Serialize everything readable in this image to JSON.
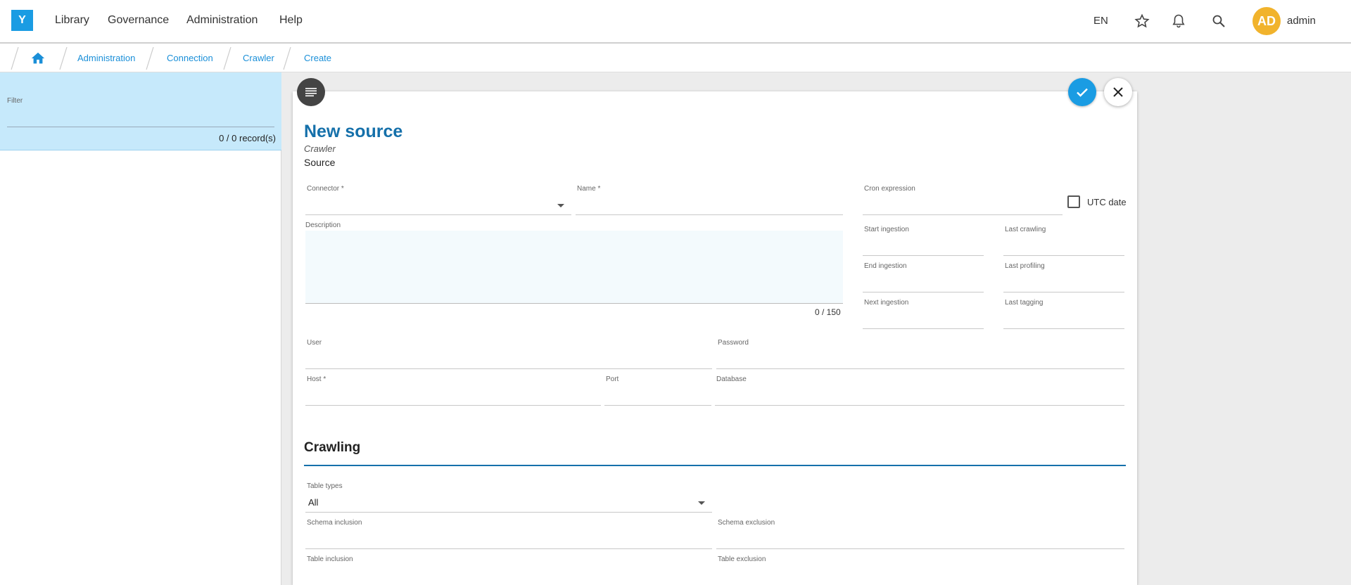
{
  "header": {
    "logo": "Y",
    "menu": [
      "Library",
      "Governance",
      "Administration",
      "Help"
    ],
    "language": "EN",
    "avatar_initials": "AD",
    "username": "admin"
  },
  "breadcrumb": [
    "Administration",
    "Connection",
    "Crawler",
    "Create"
  ],
  "left_panel": {
    "filter_label": "Filter",
    "record_count": "0 / 0 record(s)"
  },
  "form": {
    "title": "New source",
    "subtitle": "Crawler",
    "section": "Source",
    "connector_label": "Connector *",
    "name_label": "Name *",
    "cron_label": "Cron expression",
    "utc_label": "UTC date",
    "description_label": "Description",
    "description_count": "0 / 150",
    "start_ingestion_label": "Start ingestion",
    "last_crawling_label": "Last crawling",
    "end_ingestion_label": "End ingestion",
    "last_profiling_label": "Last profiling",
    "next_ingestion_label": "Next ingestion",
    "last_tagging_label": "Last tagging",
    "user_label": "User",
    "password_label": "Password",
    "host_label": "Host *",
    "port_label": "Port",
    "database_label": "Database",
    "crawling_title": "Crawling",
    "table_types_label": "Table types",
    "table_types_value": "All",
    "schema_inclusion_label": "Schema inclusion",
    "schema_exclusion_label": "Schema exclusion",
    "table_inclusion_label": "Table inclusion",
    "table_exclusion_label": "Table exclusion"
  },
  "colors": {
    "accent": "#1a9ce3",
    "title": "#1570aa",
    "avatar": "#f1b32c",
    "filter_bg": "#c6e9fb"
  }
}
